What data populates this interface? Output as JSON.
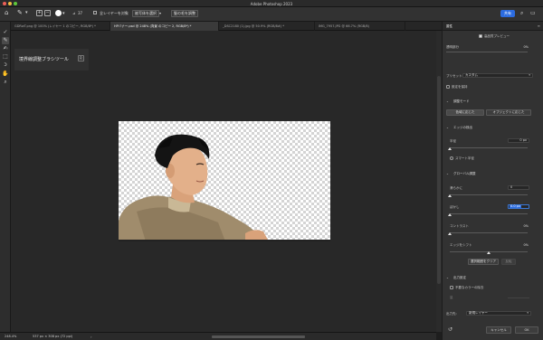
{
  "window": {
    "title": "Adobe Photoshop 2023"
  },
  "options_bar": {
    "brush_size": "37",
    "sample_all_layers": "全レイヤーを対象",
    "select_subject": "被写体を選択",
    "refine_hair": "髪の毛を調整",
    "share": "共有"
  },
  "tabs": [
    {
      "label": "GDRwT.png @ 100% (レイヤー 1 のコピー, RGB/8*) *",
      "active": false
    },
    {
      "label": "HPバナー.psd @ 248% (背景 のコピー 2, RGB/8*) *",
      "active": true
    },
    {
      "label": "_DSC2180 (1).jpg @ 50.9% (RGB/8#) *",
      "active": false
    },
    {
      "label": "IMG_7957.JPG @ 66.7% (RGB/8)",
      "active": false
    }
  ],
  "popup": {
    "title": "境界線調整ブラシツール",
    "shortcut": "R"
  },
  "status": {
    "zoom": "248.4%",
    "doc_size": "537 px × 308 px (72 ppi)"
  },
  "panel": {
    "tab": "属性",
    "hq_preview": "高品質プレビュー",
    "opacity_label": "透明部分",
    "opacity_value": "0%",
    "preset_label": "プリセット:",
    "preset_value": "カスタム",
    "remember": "設定を保持",
    "mode_header": "調整モード",
    "mode_color": "色域に応じた",
    "mode_object": "オブジェクトに応じた",
    "edge_header": "エッジの検出",
    "radius_label": "半径",
    "radius_value": "0 px",
    "smart_radius": "スマート半径",
    "global_header": "グローバル調整",
    "smooth_label": "滑らかに",
    "smooth_value": "0",
    "feather_label": "ぼかし",
    "feather_value": "0.0 px",
    "contrast_label": "コントラスト",
    "contrast_value": "0%",
    "shift_label": "エッジをシフト",
    "shift_value": "0%",
    "clear_selection": "選択範囲をクリア",
    "invert": "反転",
    "output_header": "出力設定",
    "decontam": "不要なカラーの除去",
    "amount_label": "量",
    "output_to_label": "出力先:",
    "output_to_value": "新規レイヤー",
    "cancel": "キャンセル",
    "ok": "OK"
  },
  "colors": {
    "accent": "#2c6ce0",
    "workspace": "#282828",
    "panel": "#323232"
  }
}
